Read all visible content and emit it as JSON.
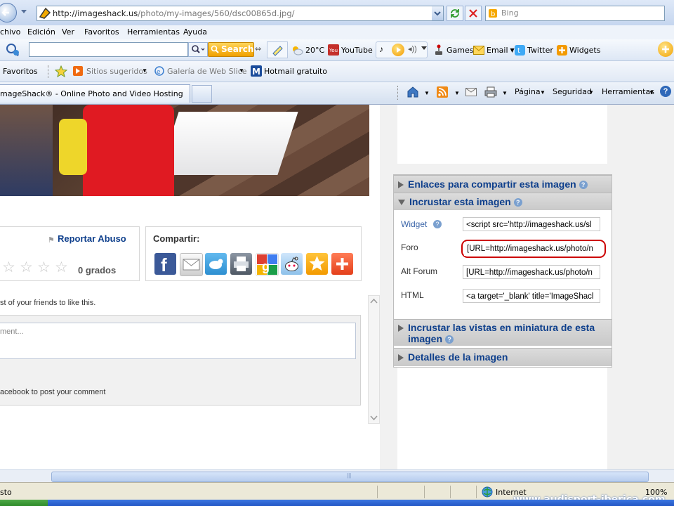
{
  "address": {
    "url_domain": "http://imageshack.us",
    "url_path": "/photo/my-images/560/dsc00865d.jpg/",
    "search_placeholder": "Bing"
  },
  "menu": [
    "chivo",
    "Edición",
    "Ver",
    "Favoritos",
    "Herramientas",
    "Ayuda"
  ],
  "toolbar": {
    "search_button": "Search",
    "weather": "20°C",
    "youtube": "YouTube",
    "games": "Games",
    "email": "Email",
    "twitter": "Twitter",
    "widgets": "Widgets"
  },
  "favorites_bar": {
    "favoritos": "Favoritos",
    "sitios": "Sitios sugeridos",
    "galeria": "Galería de Web Slice",
    "hotmail": "Hotmail gratuito"
  },
  "tab": {
    "title": "mageShack® - Online Photo and Video Hosting",
    "pagina": "Página",
    "seguridad": "Seguridad",
    "herramientas": "Herramientas"
  },
  "left": {
    "report_abuse": "Reportar Abuso",
    "share_label": "Compartir:",
    "rating": "0 grados",
    "friends_text": "st of your friends to like this.",
    "comment_placeholder": "ment...",
    "facebook_text": "acebook to post your comment"
  },
  "right": {
    "links_header": "Enlaces para compartir esta imagen",
    "embed_header": "Incrustar esta imagen",
    "rows": [
      {
        "label": "Widget",
        "value": "<script src='http://imageshack.us/sl"
      },
      {
        "label": "Foro",
        "value": "[URL=http://imageshack.us/photo/n"
      },
      {
        "label": "Alt Forum",
        "value": "[URL=http://imageshack.us/photo/n"
      },
      {
        "label": "HTML",
        "value": "<a target='_blank' title='ImageShacl"
      }
    ],
    "thumbs_header_1": "Incrustar las vistas en miniatura de esta",
    "thumbs_header_2": "imagen",
    "details_header": "Detalles de la imagen"
  },
  "status": {
    "left_text": "sto",
    "zone": "Internet",
    "zoom": "100%",
    "watermark": "www.audisport-iberica.com"
  },
  "colors": {
    "link_blue": "#0e3f8c",
    "highlight_red": "#cc0000"
  }
}
